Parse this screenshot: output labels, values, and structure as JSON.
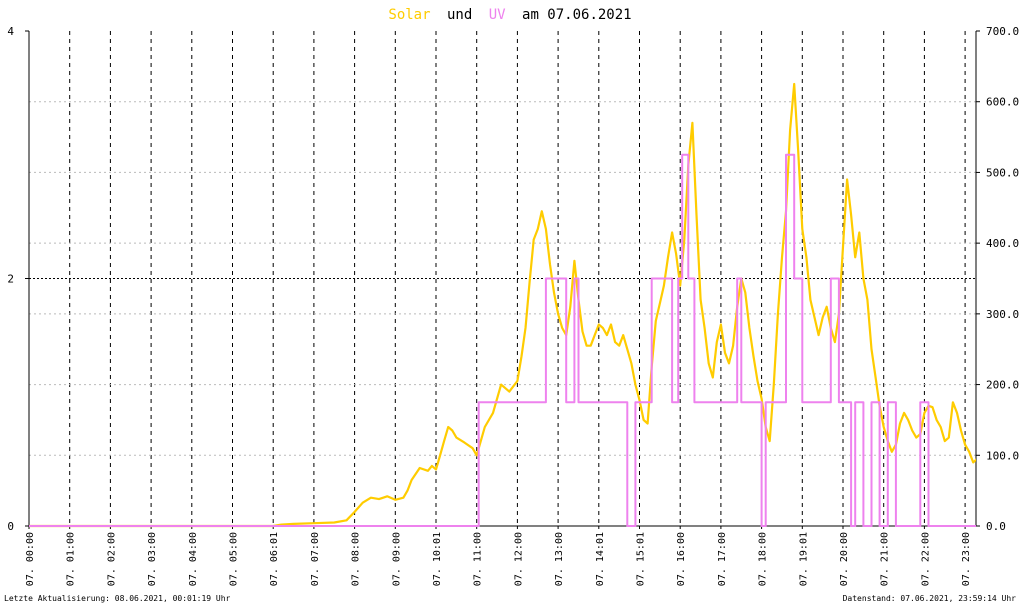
{
  "title": {
    "solar_word": "Solar",
    "und_word": "und",
    "uv_word": "UV",
    "date_part": "am 07.06.2021"
  },
  "footer": {
    "left": "Letzte Aktualisierung: 08.06.2021, 00:01:19 Uhr",
    "right": "Datenstand: 07.06.2021, 23:59:14 Uhr"
  },
  "colors": {
    "solar": "#ffcc00",
    "uv": "#ee82ee",
    "grid": "#000000",
    "background": "#ffffff"
  },
  "chart_data": {
    "type": "line",
    "x_unit": "hour",
    "x_ticks": [
      "07. 00:00",
      "07. 01:00",
      "07. 02:00",
      "07. 03:00",
      "07. 04:00",
      "07. 05:00",
      "07. 06:01",
      "07. 07:00",
      "07. 08:00",
      "07. 09:00",
      "07. 10:01",
      "07. 11:00",
      "07. 12:00",
      "07. 13:00",
      "07. 14:01",
      "07. 15:01",
      "07. 16:00",
      "07. 17:00",
      "07. 18:00",
      "07. 19:01",
      "07. 20:00",
      "07. 21:00",
      "07. 22:00",
      "07. 23:00"
    ],
    "xlim": [
      0,
      24
    ],
    "y_left": {
      "min": 0,
      "max": 4,
      "ticks": [
        "0",
        "2",
        "4"
      ]
    },
    "y_right": {
      "min": 0,
      "max": 700,
      "ticks": [
        "0.0",
        "100.0",
        "200.0",
        "300.0",
        "400.0",
        "500.0",
        "600.0",
        "700.0"
      ]
    },
    "grid": true,
    "series": [
      {
        "name": "Solar",
        "axis": "right",
        "points": [
          [
            0,
            0
          ],
          [
            6.0,
            0
          ],
          [
            6.2,
            2
          ],
          [
            6.5,
            3
          ],
          [
            7.0,
            4
          ],
          [
            7.5,
            5
          ],
          [
            7.8,
            8
          ],
          [
            8.0,
            20
          ],
          [
            8.2,
            33
          ],
          [
            8.4,
            40
          ],
          [
            8.6,
            38
          ],
          [
            8.8,
            42
          ],
          [
            9.0,
            37
          ],
          [
            9.2,
            40
          ],
          [
            9.3,
            50
          ],
          [
            9.4,
            65
          ],
          [
            9.6,
            82
          ],
          [
            9.8,
            78
          ],
          [
            9.9,
            85
          ],
          [
            10.0,
            80
          ],
          [
            10.1,
            100
          ],
          [
            10.2,
            120
          ],
          [
            10.3,
            140
          ],
          [
            10.4,
            135
          ],
          [
            10.5,
            125
          ],
          [
            10.7,
            118
          ],
          [
            10.9,
            110
          ],
          [
            11.0,
            100
          ],
          [
            11.2,
            140
          ],
          [
            11.4,
            160
          ],
          [
            11.6,
            200
          ],
          [
            11.8,
            190
          ],
          [
            12.0,
            205
          ],
          [
            12.1,
            240
          ],
          [
            12.2,
            280
          ],
          [
            12.3,
            345
          ],
          [
            12.4,
            405
          ],
          [
            12.5,
            420
          ],
          [
            12.6,
            445
          ],
          [
            12.7,
            420
          ],
          [
            12.8,
            370
          ],
          [
            12.9,
            330
          ],
          [
            13.0,
            300
          ],
          [
            13.1,
            280
          ],
          [
            13.2,
            270
          ],
          [
            13.3,
            310
          ],
          [
            13.4,
            375
          ],
          [
            13.5,
            320
          ],
          [
            13.6,
            275
          ],
          [
            13.7,
            255
          ],
          [
            13.8,
            255
          ],
          [
            13.9,
            270
          ],
          [
            14.0,
            285
          ],
          [
            14.1,
            280
          ],
          [
            14.2,
            270
          ],
          [
            14.3,
            285
          ],
          [
            14.4,
            260
          ],
          [
            14.5,
            255
          ],
          [
            14.6,
            270
          ],
          [
            14.7,
            250
          ],
          [
            14.8,
            230
          ],
          [
            14.9,
            200
          ],
          [
            15.0,
            178
          ],
          [
            15.1,
            150
          ],
          [
            15.2,
            145
          ],
          [
            15.3,
            225
          ],
          [
            15.4,
            290
          ],
          [
            15.5,
            315
          ],
          [
            15.6,
            340
          ],
          [
            15.7,
            380
          ],
          [
            15.8,
            415
          ],
          [
            15.9,
            385
          ],
          [
            16.0,
            340
          ],
          [
            16.1,
            405
          ],
          [
            16.2,
            510
          ],
          [
            16.3,
            570
          ],
          [
            16.4,
            440
          ],
          [
            16.5,
            320
          ],
          [
            16.6,
            280
          ],
          [
            16.7,
            230
          ],
          [
            16.8,
            210
          ],
          [
            16.9,
            260
          ],
          [
            17.0,
            285
          ],
          [
            17.1,
            245
          ],
          [
            17.2,
            230
          ],
          [
            17.3,
            255
          ],
          [
            17.4,
            310
          ],
          [
            17.5,
            350
          ],
          [
            17.6,
            330
          ],
          [
            17.7,
            280
          ],
          [
            17.8,
            240
          ],
          [
            17.9,
            205
          ],
          [
            18.0,
            180
          ],
          [
            18.1,
            140
          ],
          [
            18.2,
            120
          ],
          [
            18.3,
            200
          ],
          [
            18.4,
            300
          ],
          [
            18.5,
            380
          ],
          [
            18.6,
            445
          ],
          [
            18.7,
            560
          ],
          [
            18.8,
            625
          ],
          [
            18.9,
            530
          ],
          [
            19.0,
            420
          ],
          [
            19.1,
            380
          ],
          [
            19.2,
            320
          ],
          [
            19.3,
            295
          ],
          [
            19.4,
            270
          ],
          [
            19.5,
            295
          ],
          [
            19.6,
            310
          ],
          [
            19.7,
            280
          ],
          [
            19.8,
            260
          ],
          [
            19.9,
            300
          ],
          [
            20.0,
            395
          ],
          [
            20.1,
            490
          ],
          [
            20.2,
            440
          ],
          [
            20.3,
            380
          ],
          [
            20.4,
            415
          ],
          [
            20.5,
            350
          ],
          [
            20.6,
            320
          ],
          [
            20.7,
            250
          ],
          [
            20.8,
            210
          ],
          [
            20.9,
            170
          ],
          [
            21.0,
            140
          ],
          [
            21.1,
            120
          ],
          [
            21.2,
            105
          ],
          [
            21.3,
            115
          ],
          [
            21.4,
            145
          ],
          [
            21.5,
            160
          ],
          [
            21.6,
            150
          ],
          [
            21.7,
            135
          ],
          [
            21.8,
            125
          ],
          [
            21.9,
            130
          ],
          [
            22.0,
            160
          ],
          [
            22.1,
            170
          ],
          [
            22.2,
            168
          ],
          [
            22.3,
            150
          ],
          [
            22.4,
            140
          ],
          [
            22.5,
            120
          ],
          [
            22.6,
            125
          ],
          [
            22.7,
            175
          ],
          [
            22.8,
            160
          ],
          [
            22.9,
            135
          ],
          [
            23.0,
            115
          ],
          [
            23.1,
            105
          ],
          [
            23.2,
            90
          ],
          [
            23.3,
            95
          ],
          [
            23.4,
            85
          ],
          [
            23.5,
            80
          ],
          [
            23.6,
            70
          ],
          [
            23.7,
            68
          ],
          [
            23.8,
            72
          ],
          [
            23.9,
            60
          ],
          [
            24.0,
            52
          ],
          [
            24.1,
            50
          ],
          [
            24.2,
            45
          ],
          [
            24.3,
            40
          ],
          [
            24.4,
            38
          ],
          [
            24.5,
            32
          ],
          [
            24.6,
            25
          ],
          [
            24.7,
            18
          ],
          [
            24.8,
            10
          ],
          [
            24.9,
            6
          ],
          [
            25.0,
            3
          ],
          [
            25.5,
            0
          ],
          [
            27,
            0
          ]
        ]
      },
      {
        "name": "UV",
        "axis": "left",
        "points": [
          [
            0,
            0
          ],
          [
            11.05,
            0
          ],
          [
            11.05,
            1
          ],
          [
            12.7,
            1
          ],
          [
            12.7,
            2
          ],
          [
            13.2,
            2
          ],
          [
            13.2,
            1
          ],
          [
            13.4,
            1
          ],
          [
            13.4,
            2
          ],
          [
            13.5,
            2
          ],
          [
            13.5,
            1
          ],
          [
            14.7,
            1
          ],
          [
            14.7,
            0
          ],
          [
            14.9,
            0
          ],
          [
            14.9,
            1
          ],
          [
            15.3,
            1
          ],
          [
            15.3,
            2
          ],
          [
            15.8,
            2
          ],
          [
            15.8,
            1
          ],
          [
            15.95,
            1
          ],
          [
            15.95,
            2
          ],
          [
            16.05,
            2
          ],
          [
            16.05,
            3
          ],
          [
            16.2,
            3
          ],
          [
            16.2,
            2
          ],
          [
            16.35,
            2
          ],
          [
            16.35,
            1
          ],
          [
            17.4,
            1
          ],
          [
            17.4,
            2
          ],
          [
            17.5,
            2
          ],
          [
            17.5,
            1
          ],
          [
            18.0,
            1
          ],
          [
            18.0,
            0
          ],
          [
            18.1,
            0
          ],
          [
            18.1,
            1
          ],
          [
            18.6,
            1
          ],
          [
            18.6,
            3
          ],
          [
            18.8,
            3
          ],
          [
            18.8,
            2
          ],
          [
            19.0,
            2
          ],
          [
            19.0,
            1
          ],
          [
            19.7,
            1
          ],
          [
            19.7,
            2
          ],
          [
            19.9,
            2
          ],
          [
            19.9,
            1
          ],
          [
            20.2,
            1
          ],
          [
            20.2,
            0
          ],
          [
            20.3,
            0
          ],
          [
            20.3,
            1
          ],
          [
            20.5,
            1
          ],
          [
            20.5,
            0
          ],
          [
            20.7,
            0
          ],
          [
            20.7,
            1
          ],
          [
            20.9,
            1
          ],
          [
            20.9,
            0
          ],
          [
            21.1,
            0
          ],
          [
            21.1,
            1
          ],
          [
            21.3,
            1
          ],
          [
            21.3,
            0
          ],
          [
            21.9,
            0
          ],
          [
            21.9,
            1
          ],
          [
            22.1,
            1
          ],
          [
            22.1,
            0
          ],
          [
            27,
            0
          ]
        ]
      }
    ]
  }
}
